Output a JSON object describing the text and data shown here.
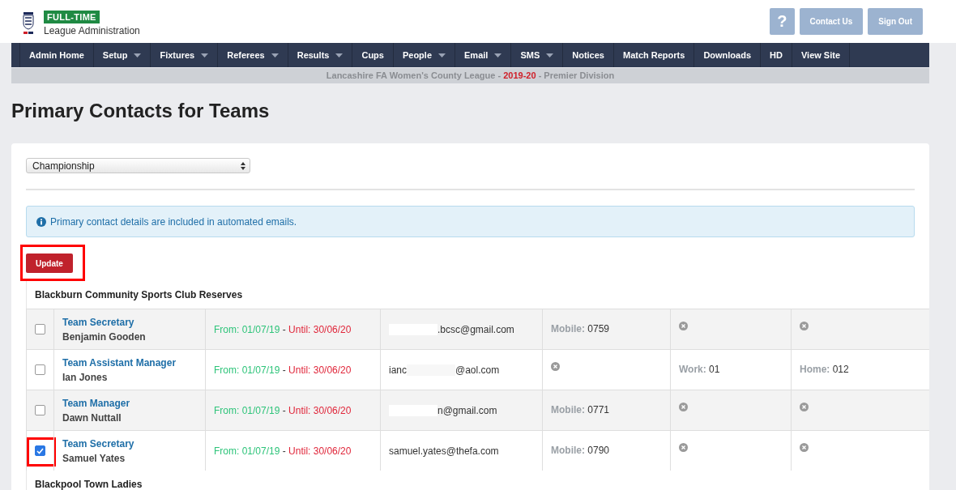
{
  "header": {
    "badge": "FULL-TIME",
    "subtitle": "League Administration",
    "buttons": [
      {
        "label": "?",
        "kind": "help"
      },
      {
        "label": "Contact Us",
        "kind": "text"
      },
      {
        "label": "Sign Out",
        "kind": "text"
      }
    ]
  },
  "nav": [
    {
      "label": "Admin Home",
      "dropdown": false
    },
    {
      "label": "Setup",
      "dropdown": true
    },
    {
      "label": "Fixtures",
      "dropdown": true
    },
    {
      "label": "Referees",
      "dropdown": true
    },
    {
      "label": "Results",
      "dropdown": true
    },
    {
      "label": "Cups",
      "dropdown": false
    },
    {
      "label": "People",
      "dropdown": true
    },
    {
      "label": "Email",
      "dropdown": true
    },
    {
      "label": "SMS",
      "dropdown": true
    },
    {
      "label": "Notices",
      "dropdown": false
    },
    {
      "label": "Match Reports",
      "dropdown": false
    },
    {
      "label": "Downloads",
      "dropdown": false
    },
    {
      "label": "HD",
      "dropdown": false
    },
    {
      "label": "View Site",
      "dropdown": false
    }
  ],
  "context_bar": [
    {
      "text": "Lancashire FA Women's County League - ",
      "kind": "plain"
    },
    {
      "text": "2019-20",
      "kind": "season"
    },
    {
      "text": " - Premier Division",
      "kind": "plain"
    }
  ],
  "page_title": "Primary Contacts for Teams",
  "division_select": {
    "value": "Championship"
  },
  "alert": "Primary contact details are included in automated emails.",
  "update_button": {
    "label": "Update",
    "highlighted": true
  },
  "teams": [
    {
      "name": "Blackburn Community Sports Club Reserves",
      "contacts": [
        {
          "checked": false,
          "highlighted": false,
          "role": "Team Secretary",
          "person": "Benjamin Gooden",
          "from": "From: 01/07/19",
          "sep": " - ",
          "until": "Until: 30/06/20",
          "email": [
            {
              "kind": "redacted"
            },
            {
              "kind": "text",
              "text": ".bcsc@gmail.com"
            }
          ],
          "phones": [
            {
              "kind": "phone",
              "label": "Mobile:",
              "value": "0759"
            },
            {
              "kind": "none"
            },
            {
              "kind": "none"
            }
          ]
        },
        {
          "checked": false,
          "highlighted": false,
          "role": "Team Assistant Manager",
          "person": "Ian Jones",
          "from": "From: 01/07/19",
          "sep": " - ",
          "until": "Until: 30/06/20",
          "email": [
            {
              "kind": "text",
              "text": "ianc"
            },
            {
              "kind": "redacted"
            },
            {
              "kind": "text",
              "text": "@aol.com"
            }
          ],
          "phones": [
            {
              "kind": "none"
            },
            {
              "kind": "phone",
              "label": "Work:",
              "value": "01"
            },
            {
              "kind": "phone",
              "label": "Home:",
              "value": "012"
            }
          ]
        },
        {
          "checked": false,
          "highlighted": false,
          "role": "Team Manager",
          "person": "Dawn Nuttall",
          "from": "From: 01/07/19",
          "sep": " - ",
          "until": "Until: 30/06/20",
          "email": [
            {
              "kind": "redacted"
            },
            {
              "kind": "text",
              "text": "n@gmail.com"
            }
          ],
          "phones": [
            {
              "kind": "phone",
              "label": "Mobile:",
              "value": "0771"
            },
            {
              "kind": "none"
            },
            {
              "kind": "none"
            }
          ]
        },
        {
          "checked": true,
          "highlighted": true,
          "role": "Team Secretary",
          "person": "Samuel Yates",
          "from": "From: 01/07/19",
          "sep": " - ",
          "until": "Until: 30/06/20",
          "email": [
            {
              "kind": "text",
              "text": "samuel.yates@thefa.com"
            }
          ],
          "phones": [
            {
              "kind": "phone",
              "label": "Mobile:",
              "value": "0790"
            },
            {
              "kind": "none"
            },
            {
              "kind": "none"
            }
          ]
        }
      ]
    },
    {
      "name": "Blackpool Town Ladies"
    }
  ]
}
